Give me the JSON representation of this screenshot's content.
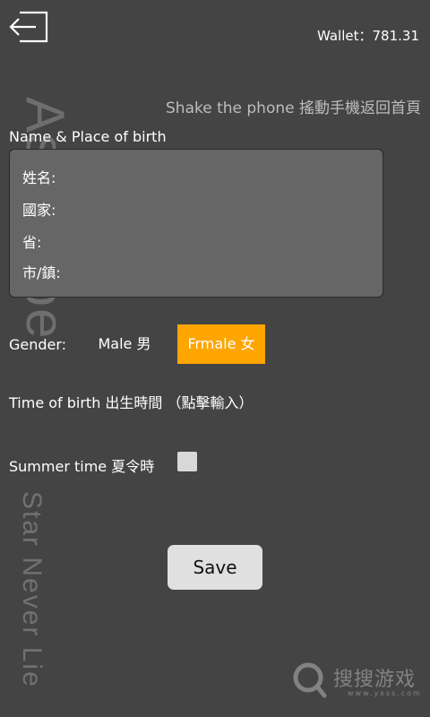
{
  "header": {
    "wallet_label": "Wallet：",
    "wallet_value": "781.31",
    "shake_hint": "Shake the phone 搖動手機返回首頁"
  },
  "watermark": {
    "title": "Astrolabe",
    "tagline": "Star Never Lie"
  },
  "form": {
    "section_label": "Name & Place of birth",
    "fields": [
      {
        "label": "姓名:",
        "value": ""
      },
      {
        "label": "國家:",
        "value": ""
      },
      {
        "label": "省:",
        "value": ""
      },
      {
        "label": "市/鎮:",
        "value": ""
      }
    ]
  },
  "gender": {
    "label": "Gender:",
    "male": "Male 男",
    "female": "Frmale 女",
    "selected": "female"
  },
  "birth_time": {
    "label": "Time of birth 出生時間 （點擊輸入）"
  },
  "summer_time": {
    "label": "Summer time 夏令時",
    "checked": false
  },
  "save_label": "Save",
  "brand": {
    "name": "搜搜游戏",
    "domain": "www.yxss.com"
  },
  "colors": {
    "background": "#444444",
    "selected_accent": "#FFA500",
    "form_box": "#666666"
  }
}
